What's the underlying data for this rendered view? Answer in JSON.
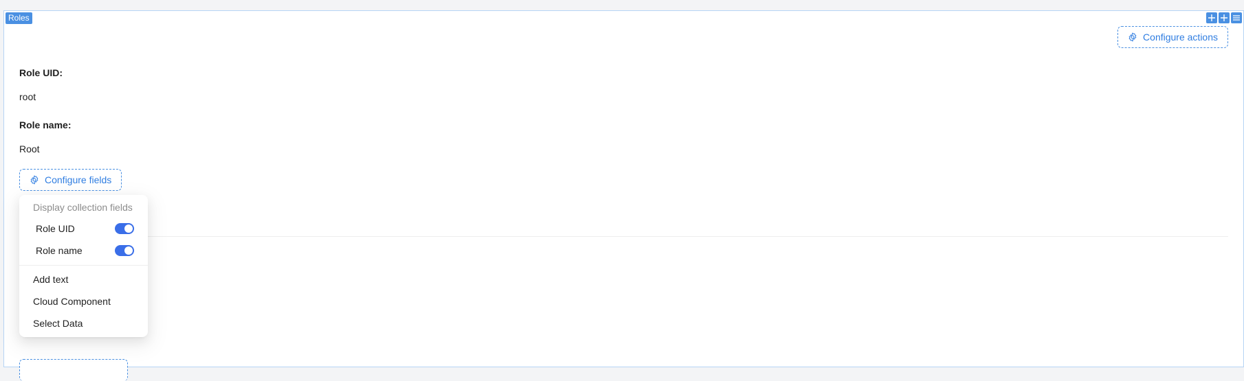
{
  "block": {
    "badge": "Roles",
    "tools": [
      "drag-icon",
      "add-icon",
      "menu-icon"
    ]
  },
  "actions": {
    "configure_label": "Configure actions"
  },
  "fields": [
    {
      "label": "Role UID",
      "value": "root"
    },
    {
      "label": "Role name",
      "value": "Root"
    }
  ],
  "field_separator": ":",
  "configure_fields_label": "Configure fields",
  "menu": {
    "group_title": "Display collection fields",
    "toggles": [
      {
        "label": "Role UID",
        "enabled": true
      },
      {
        "label": "Role name",
        "enabled": true
      }
    ],
    "items": [
      "Add text",
      "Cloud Component",
      "Select Data"
    ]
  },
  "colors": {
    "accent": "#4a90e2",
    "toggle_on": "#3a6ee8",
    "link_text": "#2f7de1"
  }
}
